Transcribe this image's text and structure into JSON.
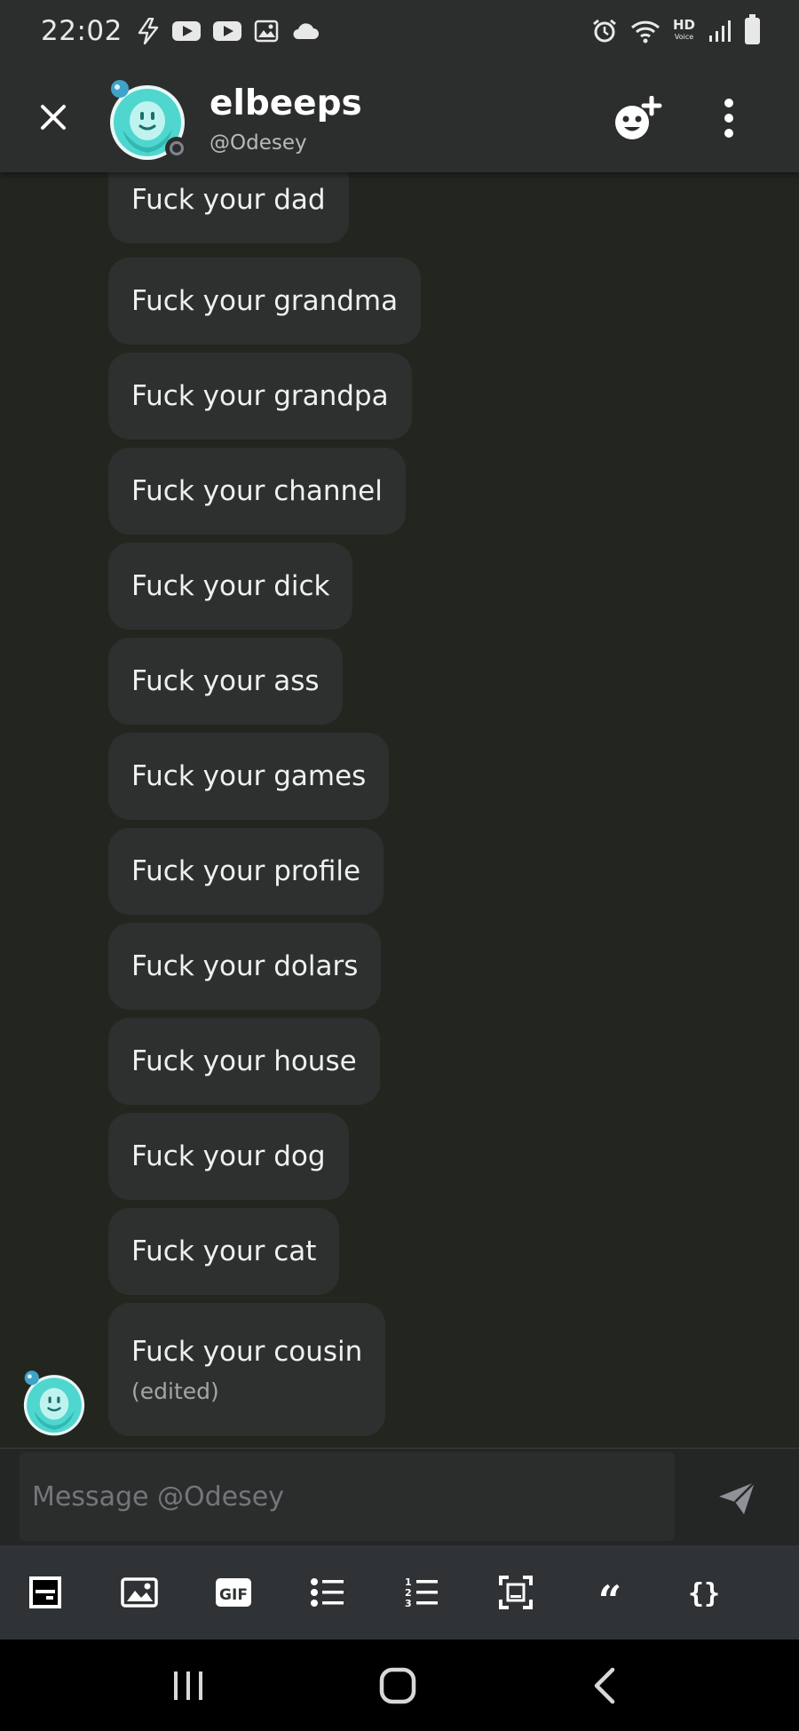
{
  "status_bar": {
    "time": "22:02",
    "left_icons": [
      "flash-icon",
      "youtube-icon",
      "youtube-icon",
      "gallery-icon",
      "cloud-icon"
    ],
    "right_icons": [
      "alarm-icon",
      "wifi-icon",
      "hd-voice-icon",
      "signal-icon",
      "battery-icon"
    ],
    "hd_label": "HD",
    "hd_sublabel": "Voice"
  },
  "header": {
    "name": "elbeeps",
    "handle": "@Odesey",
    "close_icon": "close-icon",
    "add_friend_icon": "add-friend-icon",
    "more_icon": "more-vertical-icon"
  },
  "messages": [
    {
      "text": "Fuck your dad"
    },
    {
      "text": "Fuck your grandma"
    },
    {
      "text": "Fuck your grandpa"
    },
    {
      "text": "Fuck your channel"
    },
    {
      "text": "Fuck your dick"
    },
    {
      "text": "Fuck your ass"
    },
    {
      "text": "Fuck your games"
    },
    {
      "text": "Fuck your profile"
    },
    {
      "text": "Fuck your dolars"
    },
    {
      "text": "Fuck your house"
    },
    {
      "text": "Fuck your dog"
    },
    {
      "text": "Fuck your cat"
    },
    {
      "text": "Fuck your cousin",
      "edited": "(edited)"
    }
  ],
  "composer": {
    "placeholder": "Message @Odesey",
    "send_icon": "send-icon"
  },
  "toolbar": {
    "items": [
      "spoiler-icon",
      "image-icon",
      "gif-icon",
      "bullet-list-icon",
      "numbered-list-icon",
      "code-block-icon",
      "quote-icon",
      "code-icon"
    ],
    "gif_label": "GIF",
    "quote_label": "66",
    "code_label": "{}"
  },
  "colors": {
    "background": "#23251f",
    "header": "#2c2e2e",
    "bubble": "#2d302f",
    "avatar_teal": "#4fd6cf"
  }
}
